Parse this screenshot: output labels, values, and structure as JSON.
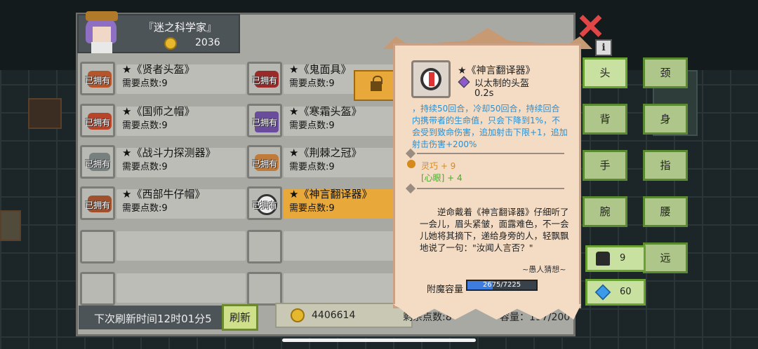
{
  "player": {
    "title": "『迷之科学家』",
    "coins": "2036"
  },
  "items": [
    {
      "owned_label": "已拥有",
      "name": "★《贤者头盔》",
      "cost": "需要点数:9",
      "icon": "red-helmet"
    },
    {
      "owned_label": "已拥有",
      "name": "★《鬼面具》",
      "cost": "需要点数:9",
      "icon": "demon-mask"
    },
    {
      "owned_label": "已拥有",
      "name": "★《国师之帽》",
      "cost": "需要点数:9",
      "icon": "red-hat"
    },
    {
      "owned_label": "已拥有",
      "name": "★《寒霜头盔》",
      "cost": "需要点数:9",
      "icon": "frost-helmet"
    },
    {
      "owned_label": "已拥有",
      "name": "★《战斗力探测器》",
      "cost": "需要点数:9",
      "icon": "scouter"
    },
    {
      "owned_label": "已拥有",
      "name": "★《荆棘之冠》",
      "cost": "需要点数:9",
      "icon": "thorn-crown"
    },
    {
      "owned_label": "已拥有",
      "name": "★《西部牛仔帽》",
      "cost": "需要点数:9",
      "icon": "cowboy-hat"
    },
    {
      "owned_label": "已拥有",
      "name": "★《神言翻译器》",
      "cost": "需要点数:9",
      "icon": "headset",
      "selected": true
    }
  ],
  "footer": {
    "refresh_text": "下次刷新时间12时01分5",
    "refresh_button": "刷新",
    "total_coins": "4406614",
    "remaining_points": "剩余点数:8",
    "capacity": "容量：197/200"
  },
  "detail": {
    "name": "★《神言翻译器》",
    "type": "以太制的头盔",
    "time": "0.2s",
    "effect": "，持续50回合，冷却50回合，持续回合内携带者的生命值，只会下降到1%，不会受到致命伤害，追加射击下限+1，追加射击伤害+200%",
    "stat_agility": "灵巧 + 9",
    "stat_eye": "[心眼] + 4",
    "lore": "逆命戴着《神言翻译器》仔细听了一会儿，眉头紧皱，面露难色，不一会儿她将其摘下，递给身旁的人，轻飘飘地说了一句：\"汝闻人言否？\"",
    "author": "~愚人猜想~",
    "enchant_label": "附魔容量",
    "enchant_text": "2675/7225",
    "enchant_ratio": 0.37
  },
  "equip_slots": {
    "head": "头",
    "neck": "颈",
    "back": "背",
    "body": "身",
    "hand": "手",
    "finger": "指",
    "wrist": "腕",
    "waist": "腰",
    "ranged": "远"
  },
  "counters": {
    "characters": "9",
    "gems": "60"
  },
  "colors": {
    "accent_gold": "#e8a83a",
    "button_green": "#c8e0a0",
    "effect_blue": "#2a8fd1"
  }
}
